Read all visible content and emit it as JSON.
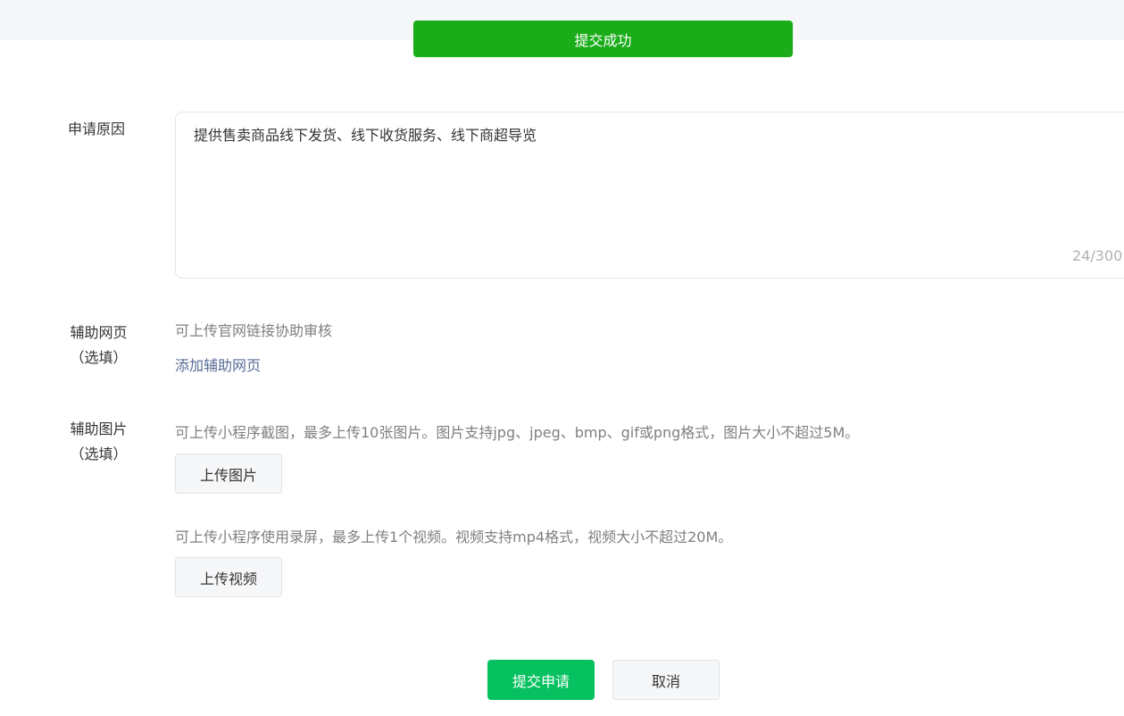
{
  "toast": {
    "message": "提交成功"
  },
  "reason": {
    "label": "申请原因",
    "value": "提供售卖商品线下发货、线下收货服务、线下商超导览",
    "counter": "24/300"
  },
  "aux_webpage": {
    "label": "辅助网页",
    "optional": "（选填）",
    "hint": "可上传官网链接协助审核",
    "add_link": "添加辅助网页"
  },
  "aux_image": {
    "label": "辅助图片",
    "optional": "（选填）",
    "image_hint": "可上传小程序截图，最多上传10张图片。图片支持jpg、jpeg、bmp、gif或png格式，图片大小不超过5M。",
    "upload_image": "上传图片",
    "video_hint": "可上传小程序使用录屏，最多上传1个视频。视频支持mp4格式，视频大小不超过20M。",
    "upload_video": "上传视频"
  },
  "actions": {
    "submit": "提交申请",
    "cancel": "取消"
  },
  "colors": {
    "toast_bg": "#1aad19",
    "primary": "#07c160",
    "link": "#576b95"
  }
}
